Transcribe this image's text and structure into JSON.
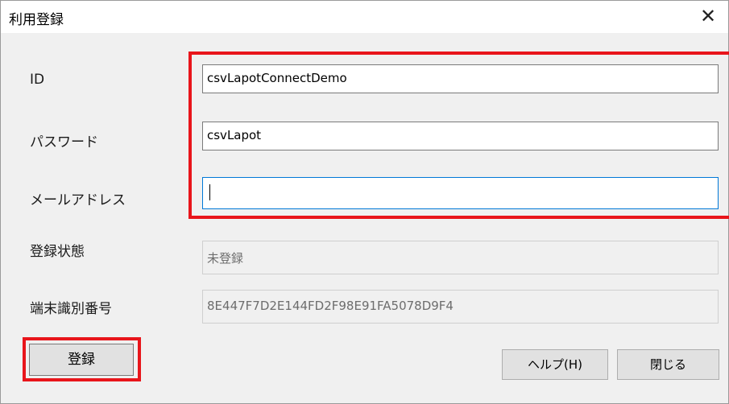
{
  "window": {
    "title": "利用登録",
    "close_glyph": "✕"
  },
  "form": {
    "id": {
      "label": "ID",
      "value": "csvLapotConnectDemo"
    },
    "password": {
      "label": "パスワード",
      "value": "csvLapot"
    },
    "email": {
      "label": "メールアドレス",
      "value": ""
    },
    "status": {
      "label": "登録状態",
      "value": "未登録"
    },
    "terminal_id": {
      "label": "端末識別番号",
      "value": "8E447F7D2E144FD2F98E91FA5078D9F4"
    }
  },
  "buttons": {
    "register": "登録",
    "help": "ヘルプ(H)",
    "close": "閉じる"
  },
  "colors": {
    "highlight": "#e8151b",
    "focus": "#0078d7"
  }
}
